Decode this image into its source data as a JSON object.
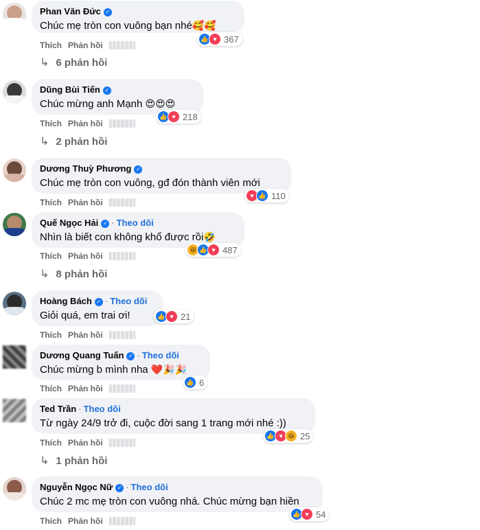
{
  "ui": {
    "like_label": "Thích",
    "reply_label": "Phản hồi",
    "separator": "·",
    "follow_label": "Theo dõi",
    "verified_glyph": "✓"
  },
  "colors": {
    "like": "#1877f2",
    "love": "#f33e58",
    "haha": "#f7b125",
    "link": "#216fdb"
  },
  "comments": [
    {
      "name": "Phan Văn Đức",
      "text": "Chúc mẹ tròn con vuông bạn nhé",
      "emoji": "🥰🥰",
      "reactions": [
        "like",
        "love"
      ],
      "count": "367",
      "replies": "6 phản hồi",
      "avatar_icon": "person-avatar"
    },
    {
      "name": "Dũng Bùi Tiến",
      "text": "Chúc mừng anh Mạnh ",
      "emoji": "😍😍😍",
      "reactions": [
        "like",
        "love"
      ],
      "count": "218",
      "replies": "2 phản hồi",
      "avatar_icon": "person-avatar"
    },
    {
      "name": "Dương Thuỳ Phương",
      "text": "Chúc mẹ tròn con vuông, gđ đón thành viên mới",
      "emoji": "",
      "reactions": [
        "love",
        "like"
      ],
      "count": "110",
      "replies": "",
      "avatar_icon": "person-avatar"
    },
    {
      "name": "Quế Ngọc Hải",
      "follow": true,
      "text": "Nhìn là biết con không khổ được rồi",
      "emoji": "🤣",
      "reactions": [
        "haha",
        "like",
        "love"
      ],
      "count": "487",
      "replies": "8 phản hồi",
      "avatar_icon": "person-avatar"
    },
    {
      "name": "Hoàng Bách",
      "follow": true,
      "text": "Giỏi quá, em trai ơi!",
      "emoji": "",
      "reactions": [
        "like",
        "love"
      ],
      "count": "21",
      "replies": "",
      "avatar_icon": "person-avatar"
    },
    {
      "name": "Dương Quang Tuấn",
      "follow": true,
      "text": "Chúc mừng b mình nha ",
      "emoji": "❤️🎉🎉",
      "reactions": [
        "like"
      ],
      "count": "6",
      "replies": "",
      "avatar_icon": "person-avatar"
    },
    {
      "name": "Ted Trần",
      "follow": true,
      "text": "Từ ngày 24/9 trở đi, cuộc đời sang 1 trang mới nhé :))",
      "emoji": "",
      "reactions": [
        "like",
        "love",
        "haha"
      ],
      "count": "25",
      "replies": "1 phản hồi",
      "avatar_icon": "person-avatar"
    },
    {
      "name": "Nguyễn Ngọc Nữ",
      "follow": true,
      "text": "Chúc 2 mc mẹ tròn con vuông nhá. Chúc mừng bạn hiền",
      "emoji": "",
      "reactions": [
        "like",
        "love"
      ],
      "count": "54",
      "replies": "",
      "avatar_icon": "person-avatar"
    }
  ]
}
